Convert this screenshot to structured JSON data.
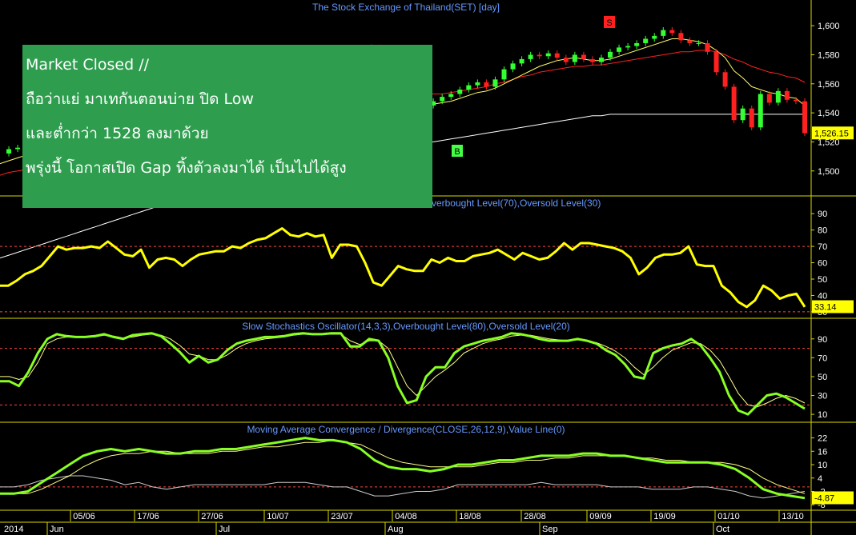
{
  "colors": {
    "background": "#000000",
    "axis_frame": "#d8d800",
    "up_candle": "#33ff33",
    "down_candle": "#ff2020",
    "rsi_line": "#ffff00",
    "stoch_k": "#88ff22",
    "stoch_d": "#ffff88",
    "macd_line": "#88ff22",
    "macd_signal": "#ffff88",
    "ma_short": "#ffff66",
    "ma_mid": "#ff2020",
    "ma_long": "#ffffff",
    "title_text": "#6699ff",
    "level_line": "#ff4444",
    "badge_s": "#ff2020",
    "badge_b": "#44ff44"
  },
  "note": {
    "lines": [
      "Market Closed //",
      "ถือว่าแย่ มาเทกันตอนบ่าย ปิด Low",
      "และต่ำกว่า 1528 ลงมาด้วย",
      "พรุ่งนี้ โอกาสเปิด Gap ทิ้งตัวลงมาได้ เป็นไปได้สูง"
    ]
  },
  "chart_data": [
    {
      "type": "candlestick",
      "title": "The Stock Exchange of Thailand(SET) [day]",
      "ylim": [
        1485,
        1610
      ],
      "y_ticks": [
        "1,500",
        "1,520",
        "1,540",
        "1,560",
        "1,580",
        "1,600"
      ],
      "last_value_label": "1,526.15",
      "markers": [
        {
          "label": "S",
          "date": "07/09"
        },
        {
          "label": "B",
          "date": "18/08"
        }
      ],
      "close": [
        1512,
        1515,
        1516,
        1518,
        1520,
        1522,
        1524,
        1526,
        1525,
        1527,
        1530,
        1533,
        1532,
        1535,
        1537,
        1540,
        1542,
        1545,
        1547,
        1549,
        1551,
        1553,
        1556,
        1558,
        1560,
        1562,
        1565,
        1567,
        1569,
        1571,
        1573,
        1575,
        1576,
        1577,
        1578,
        1577,
        1579,
        1581,
        1580,
        1582,
        1584,
        1583,
        1585,
        1540,
        1536,
        1538,
        1541,
        1543,
        1545,
        1548,
        1551,
        1553,
        1556,
        1559,
        1561,
        1558,
        1563,
        1570,
        1574,
        1577,
        1580,
        1579,
        1581,
        1578,
        1575,
        1580,
        1577,
        1575,
        1578,
        1582,
        1585,
        1586,
        1588,
        1591,
        1593,
        1597,
        1595,
        1590,
        1588,
        1588,
        1582,
        1568,
        1558,
        1535,
        1543,
        1530,
        1553,
        1547,
        1555,
        1549,
        1548,
        1526
      ],
      "ma_short": [
        1505,
        1507,
        1509,
        1511,
        1513,
        1515,
        1517,
        1519,
        1520,
        1522,
        1524,
        1526,
        1527,
        1529,
        1531,
        1533,
        1535,
        1537,
        1539,
        1541,
        1543,
        1545,
        1547,
        1549,
        1551,
        1553,
        1555,
        1557,
        1559,
        1561,
        1563,
        1565,
        1567,
        1569,
        1570,
        1571,
        1572,
        1573,
        1574,
        1575,
        1576,
        1577,
        1578,
        1569,
        1560,
        1553,
        1548,
        1546,
        1545,
        1546,
        1547,
        1548,
        1550,
        1552,
        1554,
        1555,
        1557,
        1560,
        1563,
        1566,
        1569,
        1572,
        1574,
        1576,
        1577,
        1578,
        1577,
        1576,
        1576,
        1577,
        1579,
        1581,
        1583,
        1585,
        1587,
        1589,
        1591,
        1591,
        1590,
        1589,
        1587,
        1583,
        1578,
        1569,
        1564,
        1558,
        1556,
        1554,
        1553,
        1551,
        1550,
        1545
      ],
      "ma_mid": [
        1497,
        1499,
        1500,
        1501,
        1503,
        1504,
        1506,
        1507,
        1508,
        1510,
        1511,
        1513,
        1514,
        1515,
        1517,
        1518,
        1519,
        1521,
        1522,
        1524,
        1525,
        1527,
        1528,
        1530,
        1531,
        1532,
        1534,
        1535,
        1537,
        1538,
        1540,
        1541,
        1543,
        1544,
        1546,
        1547,
        1548,
        1550,
        1551,
        1552,
        1554,
        1555,
        1556,
        1555,
        1553,
        1552,
        1552,
        1552,
        1552,
        1553,
        1553,
        1554,
        1555,
        1556,
        1557,
        1558,
        1560,
        1561,
        1563,
        1565,
        1566,
        1568,
        1569,
        1570,
        1571,
        1572,
        1572,
        1573,
        1573,
        1574,
        1575,
        1576,
        1577,
        1578,
        1579,
        1580,
        1581,
        1582,
        1582,
        1583,
        1583,
        1582,
        1580,
        1577,
        1575,
        1572,
        1570,
        1568,
        1567,
        1565,
        1564,
        1561
      ],
      "ma_long": [
        1440,
        1442,
        1444,
        1446,
        1448,
        1450,
        1452,
        1454,
        1456,
        1458,
        1460,
        1462,
        1464,
        1466,
        1468,
        1470,
        1472,
        1474,
        1476,
        1478,
        1480,
        1482,
        1484,
        1486,
        1488,
        1490,
        1492,
        1494,
        1496,
        1498,
        1500,
        1502,
        1503,
        1504,
        1505,
        1506,
        1507,
        1508,
        1509,
        1510,
        1511,
        1512,
        1513,
        1514,
        1515,
        1516,
        1517,
        1518,
        1519,
        1520,
        1521,
        1522,
        1523,
        1524,
        1525,
        1526,
        1527,
        1528,
        1529,
        1530,
        1531,
        1532,
        1533,
        1534,
        1535,
        1536,
        1537,
        1538,
        1538,
        1539,
        1539,
        1539,
        1539,
        1539,
        1539,
        1539,
        1539,
        1539,
        1539,
        1539,
        1539,
        1539,
        1539,
        1539,
        1539,
        1539,
        1539,
        1539,
        1539,
        1539,
        1539,
        1539
      ]
    },
    {
      "type": "line",
      "title": "RSI(14),Overbought Level(70),Oversold Level(30)",
      "title_visible": "Overbought Level(70),Oversold Level(30)",
      "ylim": [
        28,
        94
      ],
      "y_ticks": [
        "30",
        "40",
        "50",
        "60",
        "70",
        "80",
        "90"
      ],
      "levels": [
        70,
        30
      ],
      "last_value_label": "33.14",
      "series": [
        {
          "name": "RSI",
          "values": [
            46,
            46,
            49,
            53,
            55,
            58,
            64,
            70,
            68,
            69,
            69,
            70,
            69,
            73,
            69,
            65,
            64,
            68,
            57,
            62,
            63,
            62,
            58,
            62,
            65,
            66,
            67,
            67,
            70,
            69,
            72,
            74,
            75,
            78,
            81,
            77,
            76,
            78,
            76,
            77,
            63,
            71,
            71,
            70,
            60,
            48,
            46,
            52,
            58,
            56,
            55,
            55,
            62,
            60,
            63,
            61,
            61,
            64,
            65,
            66,
            68,
            65,
            62,
            66,
            64,
            62,
            63,
            67,
            72,
            68,
            72,
            72,
            71,
            70,
            69,
            67,
            63,
            53,
            57,
            63,
            65,
            65,
            66,
            70,
            59,
            58,
            58,
            46,
            42,
            36,
            33,
            37,
            46,
            43,
            38,
            40,
            41,
            33
          ]
        }
      ]
    },
    {
      "type": "line",
      "title": "Slow Stochastics Oscillator(14,3,3),Overbought Level(80),Oversold Level(20)",
      "ylim": [
        5,
        100
      ],
      "y_ticks": [
        "10",
        "30",
        "50",
        "70",
        "90"
      ],
      "levels": [
        80,
        20
      ],
      "series": [
        {
          "name": "%K",
          "values": [
            45,
            45,
            40,
            55,
            75,
            90,
            95,
            93,
            92,
            92,
            93,
            95,
            92,
            90,
            94,
            95,
            96,
            93,
            85,
            76,
            65,
            72,
            65,
            68,
            78,
            85,
            88,
            90,
            92,
            92,
            93,
            95,
            96,
            95,
            95,
            96,
            96,
            82,
            82,
            90,
            88,
            70,
            40,
            22,
            25,
            50,
            60,
            60,
            75,
            82,
            85,
            88,
            90,
            92,
            96,
            95,
            93,
            90,
            88,
            88,
            88,
            90,
            88,
            85,
            78,
            73,
            63,
            50,
            48,
            75,
            80,
            83,
            85,
            90,
            83,
            70,
            55,
            30,
            14,
            10,
            20,
            30,
            32,
            28,
            22,
            16
          ]
        },
        {
          "name": "%D",
          "values": [
            50,
            50,
            47,
            50,
            65,
            85,
            90,
            92,
            92,
            92,
            92,
            94,
            93,
            91,
            92,
            94,
            95,
            94,
            90,
            83,
            74,
            72,
            68,
            68,
            73,
            80,
            85,
            88,
            90,
            91,
            92,
            94,
            95,
            95,
            95,
            95,
            95,
            88,
            84,
            88,
            88,
            80,
            60,
            40,
            30,
            40,
            50,
            57,
            65,
            75,
            80,
            85,
            88,
            90,
            93,
            94,
            94,
            92,
            90,
            89,
            88,
            89,
            88,
            86,
            82,
            77,
            70,
            60,
            52,
            60,
            70,
            78,
            82,
            86,
            85,
            78,
            67,
            50,
            32,
            20,
            18,
            22,
            27,
            30,
            27,
            22
          ]
        }
      ]
    },
    {
      "type": "line",
      "title": "Moving Average Convergence / Divergence(CLOSE,26,12,9),Value Line(0)",
      "ylim": [
        -9,
        24
      ],
      "y_ticks": [
        "22",
        "16",
        "10",
        "4",
        "-2",
        "-8"
      ],
      "levels": [
        0
      ],
      "last_value_label": "-4.87",
      "series": [
        {
          "name": "MACD",
          "values": [
            -3,
            -3,
            -2,
            2,
            6,
            10,
            14,
            16,
            17,
            16,
            17,
            16,
            15,
            15,
            16,
            16,
            17,
            17,
            18,
            19,
            20,
            21,
            22,
            21,
            21,
            20,
            17,
            12,
            9,
            8,
            8,
            7,
            8,
            10,
            10,
            11,
            12,
            12,
            13,
            14,
            14,
            14,
            15,
            15,
            14,
            14,
            13,
            12,
            11,
            11,
            11,
            11,
            10,
            8,
            4,
            -1,
            -3,
            -4,
            -5
          ]
        },
        {
          "name": "Signal",
          "values": [
            -3,
            -3,
            -3,
            -1,
            2,
            5,
            9,
            12,
            14,
            15,
            15,
            16,
            16,
            15,
            15,
            15,
            16,
            16,
            17,
            18,
            18,
            19,
            20,
            20,
            21,
            20,
            19,
            16,
            13,
            11,
            10,
            9,
            9,
            9,
            9,
            10,
            11,
            11,
            12,
            12,
            13,
            13,
            14,
            14,
            14,
            14,
            13,
            13,
            12,
            12,
            11,
            11,
            11,
            10,
            8,
            4,
            1,
            -1,
            -3
          ]
        },
        {
          "name": "Histogram",
          "values": [
            0,
            0,
            1,
            3,
            4,
            5,
            5,
            4,
            3,
            1,
            2,
            0,
            -1,
            0,
            1,
            1,
            1,
            1,
            1,
            1,
            2,
            2,
            2,
            1,
            0,
            0,
            -2,
            -4,
            -4,
            -3,
            -2,
            -2,
            -1,
            1,
            1,
            1,
            1,
            1,
            1,
            2,
            1,
            1,
            1,
            1,
            0,
            0,
            0,
            -1,
            -1,
            -1,
            0,
            0,
            -1,
            -2,
            -4,
            -5,
            -4,
            -3,
            -2
          ]
        }
      ]
    }
  ],
  "x_axis": {
    "day_ticks": [
      "05/06",
      "17/06",
      "27/06",
      "10/07",
      "23/07",
      "04/08",
      "18/08",
      "28/08",
      "09/09",
      "19/09",
      "01/10",
      "13/10"
    ],
    "month_labels": [
      "2014",
      "Jun",
      "Jul",
      "Aug",
      "Sep",
      "Oct"
    ]
  }
}
